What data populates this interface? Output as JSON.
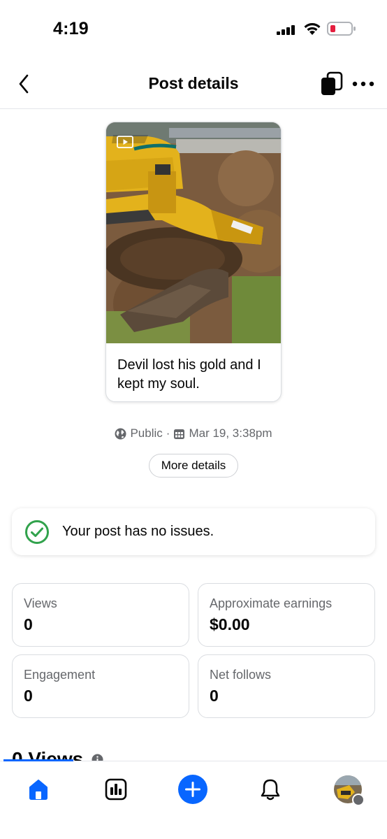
{
  "status_bar": {
    "time": "4:19"
  },
  "header": {
    "title": "Post details"
  },
  "post": {
    "caption": "Devil lost his gold and I kept my soul.",
    "privacy": "Public",
    "separator": "·",
    "date": "Mar 19, 3:38pm",
    "more_details_label": "More details"
  },
  "issues": {
    "text": "Your post has no issues."
  },
  "stats": [
    {
      "label": "Views",
      "value": "0"
    },
    {
      "label": "Approximate earnings",
      "value": "$0.00"
    },
    {
      "label": "Engagement",
      "value": "0"
    },
    {
      "label": "Net follows",
      "value": "0"
    }
  ],
  "section": {
    "heading": "0 Views"
  },
  "colors": {
    "accent": "#0866ff",
    "success": "#31a24c",
    "secondary_text": "#65676b",
    "battery_low": "#e41e3f"
  },
  "icons": {
    "back": "chevron-left-icon",
    "share": "copy-icon",
    "more": "more-horizontal-icon",
    "privacy": "globe-icon",
    "date": "calendar-icon",
    "status": "check-circle-icon",
    "nav": [
      "home-icon",
      "insights-icon",
      "create-plus-icon",
      "bell-icon",
      "profile-avatar"
    ]
  }
}
